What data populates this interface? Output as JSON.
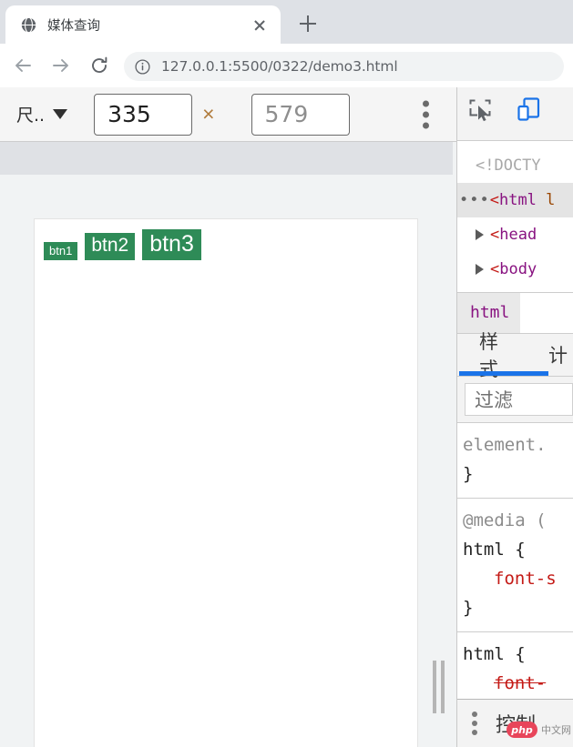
{
  "browser": {
    "tab": {
      "title": "媒体查询",
      "favicon_icon": "globe-icon",
      "close_icon": "close-icon"
    },
    "new_tab_icon": "plus-icon",
    "nav": {
      "back_icon": "arrow-left-icon",
      "forward_icon": "arrow-right-icon",
      "reload_icon": "reload-icon"
    },
    "omnibox": {
      "info_icon": "info-circle-icon",
      "url": "127.0.0.1:5500/0322/demo3.html"
    }
  },
  "device_toolbar": {
    "device_label": "尺..",
    "caret_icon": "chevron-down-icon",
    "width": "335",
    "height": "579",
    "height_placeholder": "579",
    "times": "×",
    "menu_icon": "kebab-menu-icon"
  },
  "page": {
    "buttons": [
      {
        "label": "btn1"
      },
      {
        "label": "btn2"
      },
      {
        "label": "btn3"
      }
    ],
    "button_color": "#2e8b57",
    "resize_handle_icon": "resize-handle-icon"
  },
  "devtools": {
    "toolbar": {
      "inspect_icon": "inspect-element-icon",
      "device_toggle_icon": "device-toolbar-icon"
    },
    "dom": {
      "rows": [
        {
          "text": "<!DOCTY",
          "kind": "doctype"
        },
        {
          "dots": "•••",
          "lt": "<",
          "tag": "html",
          "attr": "l",
          "kind": "tag",
          "selected": true
        },
        {
          "lt": "<",
          "tag": "head",
          "kind": "tag",
          "collapsed": true
        },
        {
          "lt": "<",
          "tag": "body",
          "kind": "tag",
          "collapsed": true
        }
      ]
    },
    "breadcrumb": {
      "items": [
        "html"
      ]
    },
    "tabs": [
      {
        "label": "样式",
        "active": true
      },
      {
        "label": "计",
        "active": false
      }
    ],
    "filter": {
      "placeholder": "过滤",
      "value": ""
    },
    "styles": [
      {
        "selector": "element.",
        "selector_kind": "element",
        "declarations": [],
        "close": "}"
      },
      {
        "selector": "@media (",
        "selector_kind": "media",
        "sub_selector": "html {",
        "declarations": [
          {
            "text": "font-s",
            "struck": false
          }
        ],
        "close": "}"
      },
      {
        "selector": "html {",
        "selector_kind": "html",
        "declarations": [
          {
            "text": "font-",
            "struck": true
          }
        ],
        "close": ""
      }
    ],
    "console": {
      "menu_icon": "kebab-menu-icon",
      "label": "控制"
    }
  },
  "watermark": {
    "badge": "php",
    "text": "中文网"
  },
  "colors": {
    "accent_blue": "#1a73e8",
    "button_green": "#2e8b57",
    "tagname_purple": "#881280",
    "property_red": "#c41a16"
  }
}
